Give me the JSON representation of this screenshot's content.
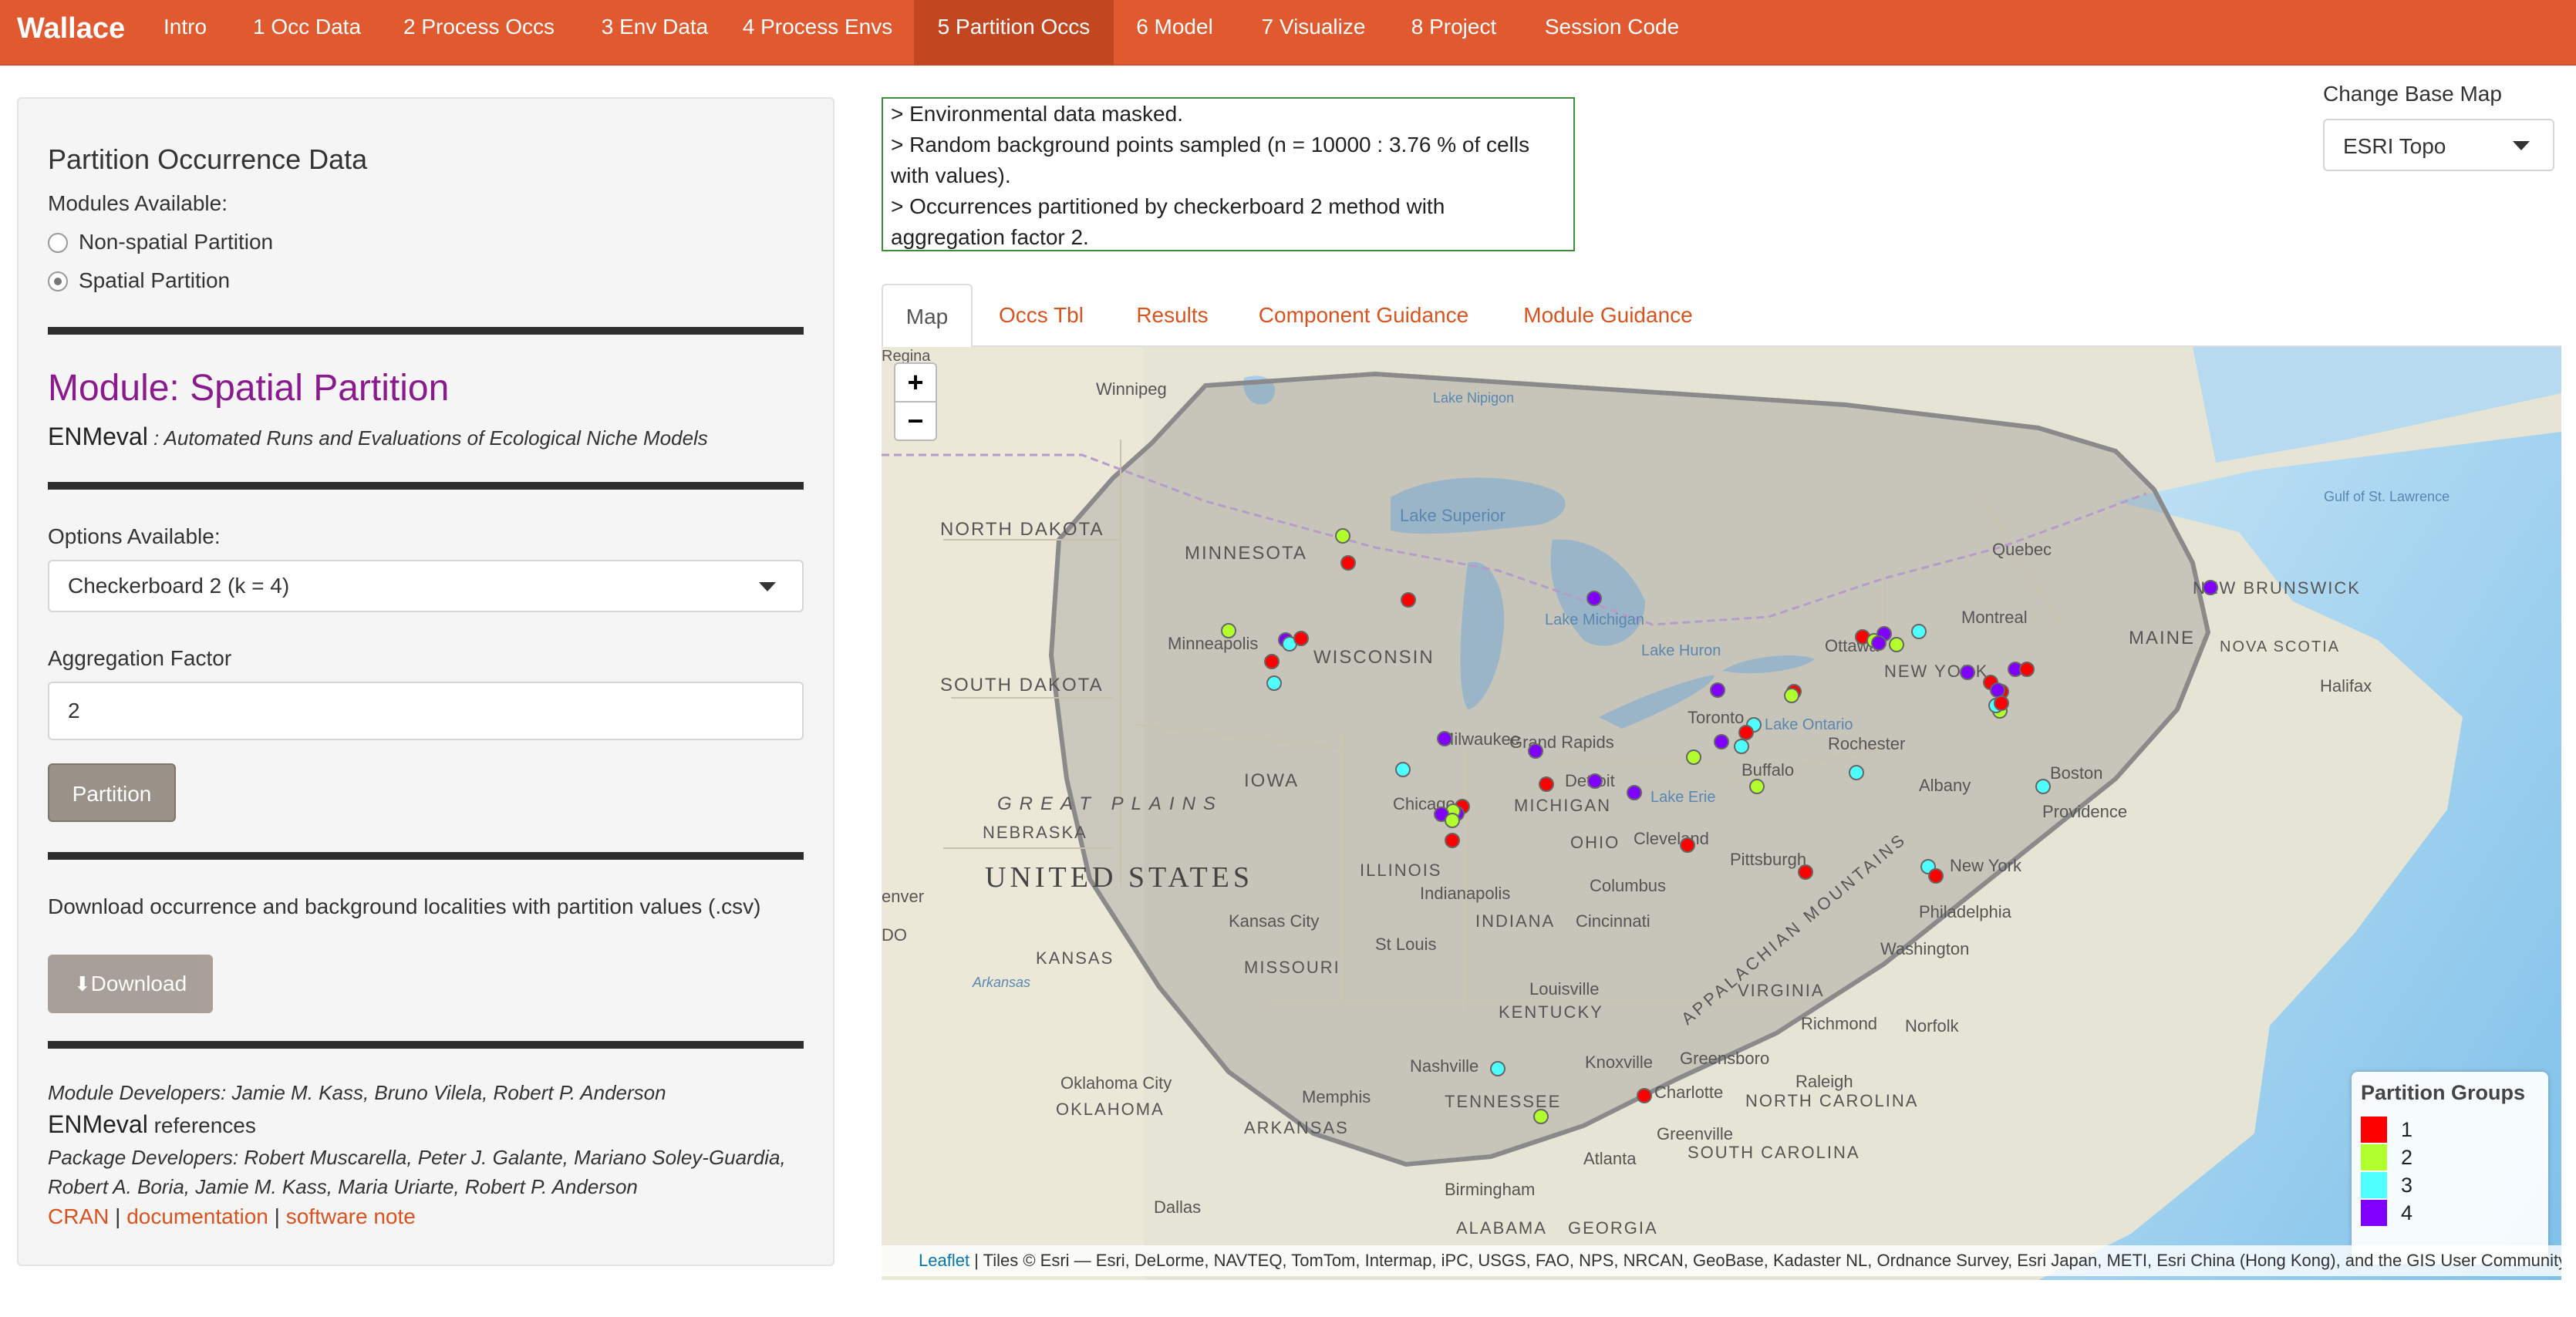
{
  "app": {
    "brand": "Wallace"
  },
  "nav": {
    "tabs": [
      {
        "label": "Intro"
      },
      {
        "label": "1 Occ Data"
      },
      {
        "label": "2 Process Occs"
      },
      {
        "label": "3 Env Data"
      },
      {
        "label": "4 Process Envs"
      },
      {
        "label": "5 Partition Occs"
      },
      {
        "label": "6 Model"
      },
      {
        "label": "7 Visualize"
      },
      {
        "label": "8 Project"
      },
      {
        "label": "Session Code"
      }
    ],
    "active": "5 Partition Occs"
  },
  "sidebar": {
    "title": "Partition Occurrence Data",
    "modules_label": "Modules Available:",
    "modules": [
      {
        "label": "Non-spatial Partition",
        "checked": false
      },
      {
        "label": "Spatial Partition",
        "checked": true
      }
    ],
    "module_heading": "Module: Spatial Partition",
    "package_name": "ENMeval",
    "package_desc": " : Automated Runs and Evaluations of Ecological Niche Models",
    "options_label": "Options Available:",
    "options_selected": "Checkerboard 2 (k = 4)",
    "agg_label": "Aggregation Factor",
    "agg_value": "2",
    "partition_button": "Partition",
    "download_text": "Download occurrence and background localities with partition values (.csv)",
    "download_button": "Download",
    "module_devs": "Module Developers: Jamie M. Kass, Bruno Vilela, Robert P. Anderson",
    "references_pkg": "ENMeval",
    "references_word": " references",
    "package_devs_line1": "Package Developers: Robert Muscarella, Peter J. Galante, Mariano Soley-Guardia,",
    "package_devs_line2": "Robert A. Boria, Jamie M. Kass, Maria Uriarte, Robert P. Anderson",
    "links": {
      "cran": "CRAN",
      "sep1": " | ",
      "documentation": "documentation",
      "sep2": " | ",
      "software_note": "software note"
    }
  },
  "log": {
    "lines": [
      "> Environmental data masked.",
      "> Random background points sampled (n = 10000 : 3.76 % of cells",
      "with values).",
      "> Occurrences partitioned by checkerboard 2 method with",
      "aggregation factor 2."
    ]
  },
  "basemap": {
    "label": "Change Base Map",
    "selected": "ESRI Topo"
  },
  "tabs": [
    {
      "label": "Map",
      "active": true
    },
    {
      "label": "Occs Tbl"
    },
    {
      "label": "Results"
    },
    {
      "label": "Component Guidance"
    },
    {
      "label": "Module Guidance"
    }
  ],
  "map": {
    "zoom_in": "+",
    "zoom_out": "−",
    "labels": {
      "regina": "Regina",
      "winnipeg": "Winnipeg",
      "lake_nipigon": "Lake Nipigon",
      "north_dakota": "NORTH DAKOTA",
      "minnesota": "MINNESOTA",
      "lake_superior": "Lake Superior",
      "quebec": "Quebec",
      "gulf": "Gulf of St. Lawrence",
      "new_brunswick": "NEW BRUNSWICK",
      "minneapolis": "Minneapolis",
      "wisconsin": "WISCONSIN",
      "lake_michigan": "Lake Michigan",
      "lake_huron": "Lake Huron",
      "ottawa": "Ottawa",
      "montreal": "Montreal",
      "maine": "MAINE",
      "nova_scotia": "NOVA SCOTIA",
      "halifax": "Halifax",
      "south_dakota": "SOUTH DAKOTA",
      "new_york_state": "NEW YORK",
      "toronto": "Toronto",
      "lake_ontario": "Lake Ontario",
      "milwaukee": "Milwaukee",
      "grand_rapids": "Grand Rapids",
      "rochester": "Rochester",
      "detroit": "Detroit",
      "buffalo": "Buffalo",
      "albany": "Albany",
      "boston": "Boston",
      "iowa": "IOWA",
      "chicago": "Chicago",
      "michigan": "MICHIGAN",
      "lake_erie": "Lake Erie",
      "providence": "Providence",
      "great_plains": "GREAT PLAINS",
      "nebraska": "NEBRASKA",
      "ohio": "OHIO",
      "cleveland": "Cleveland",
      "pittsburgh": "Pittsburgh",
      "new_york": "New York",
      "united_states": "UNITED STATES",
      "illinois": "ILLINOIS",
      "indianapolis": "Indianapolis",
      "columbus": "Columbus",
      "philadelphia": "Philadelphia",
      "appalachian": "APPALACHIAN MOUNTAINS",
      "denver": "enver",
      "kansas_city": "Kansas City",
      "indiana": "INDIANA",
      "cincinnati": "Cincinnati",
      "washington": "Washington",
      "st_louis": "St Louis",
      "kansas": "KANSAS",
      "missouri": "MISSOURI",
      "arkansas_river": "Arkansas",
      "louisville": "Louisville",
      "virginia": "VIRGINIA",
      "kentucky": "KENTUCKY",
      "richmond": "Richmond",
      "norfolk": "Norfolk",
      "greensboro": "Greensboro",
      "raleigh": "Raleigh",
      "nashville": "Nashville",
      "knoxville": "Knoxville",
      "oklahoma_city": "Oklahoma City",
      "memphis": "Memphis",
      "tennessee": "TENNESSEE",
      "charlotte": "Charlotte",
      "north_carolina": "NORTH CAROLINA",
      "oklahoma": "OKLAHOMA",
      "arkansas": "ARKANSAS",
      "greenville": "Greenville",
      "south_carolina": "SOUTH CAROLINA",
      "atlanta": "Atlanta",
      "birmingham": "Birmingham",
      "dallas": "Dallas",
      "alabama": "ALABAMA",
      "georgia": "GEORGIA",
      "do": "DO"
    },
    "legend": {
      "title": "Partition Groups",
      "groups": [
        {
          "label": "1",
          "color": "#ff0000"
        },
        {
          "label": "2",
          "color": "#b2ff2e"
        },
        {
          "label": "3",
          "color": "#4fffff"
        },
        {
          "label": "4",
          "color": "#8000ff"
        }
      ]
    },
    "attribution": {
      "leaflet": "Leaflet",
      "text": " | Tiles © Esri — Esri, DeLorme, NAVTEQ, TomTom, Intermap, iPC, USGS, FAO, NPS, NRCAN, GeoBase, Kadaster NL, Ordnance Survey, Esri Japan, METI, Esri China (Hong Kong), and the GIS User Community"
    }
  }
}
